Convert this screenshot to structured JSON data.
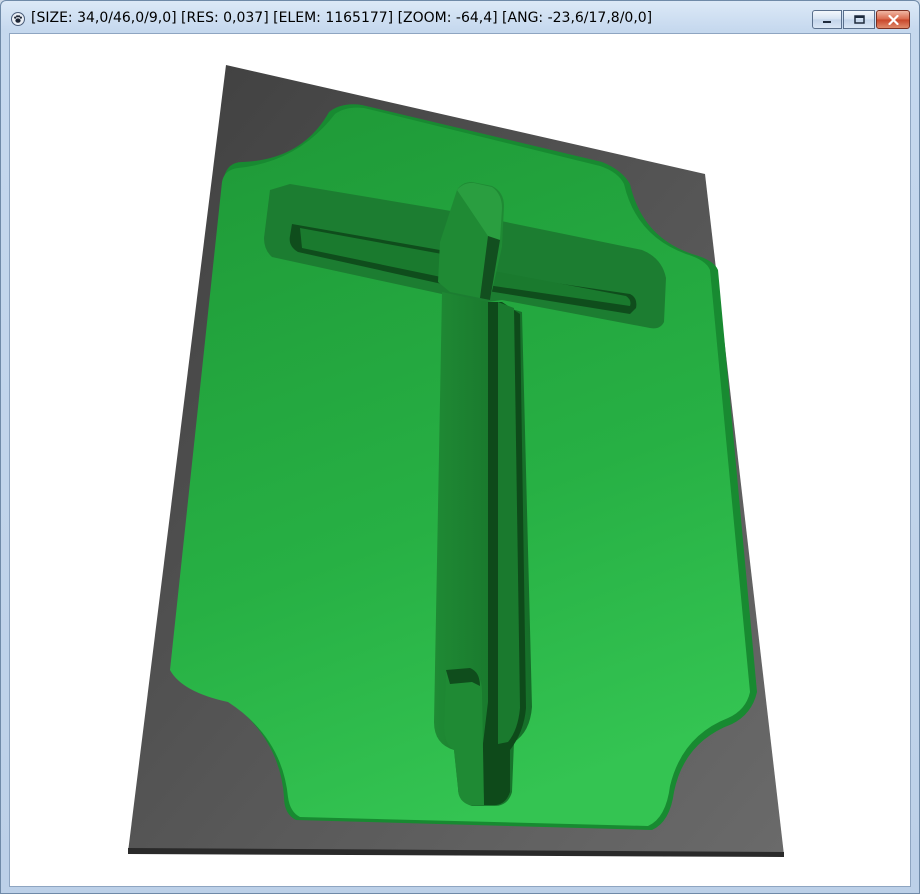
{
  "window": {
    "title": "[SIZE: 34,0/46,0/9,0] [RES: 0,037] [ELEM: 1165177] [ZOOM: -64,4] [ANG: -23,6/17,8/0,0]",
    "app_icon": "paw-icon",
    "controls": {
      "minimize": "minimize-icon",
      "maximize": "maximize-icon",
      "close": "close-icon"
    }
  },
  "viewport": {
    "colors": {
      "base": "#555555",
      "base_dark": "#3a3a3a",
      "plate": "#2cb94a",
      "plate_light": "#3ed05a",
      "pocket_wall": "#1f8a34",
      "pocket_wall_dark": "#0f4d1c",
      "background": "#ffffff"
    }
  }
}
